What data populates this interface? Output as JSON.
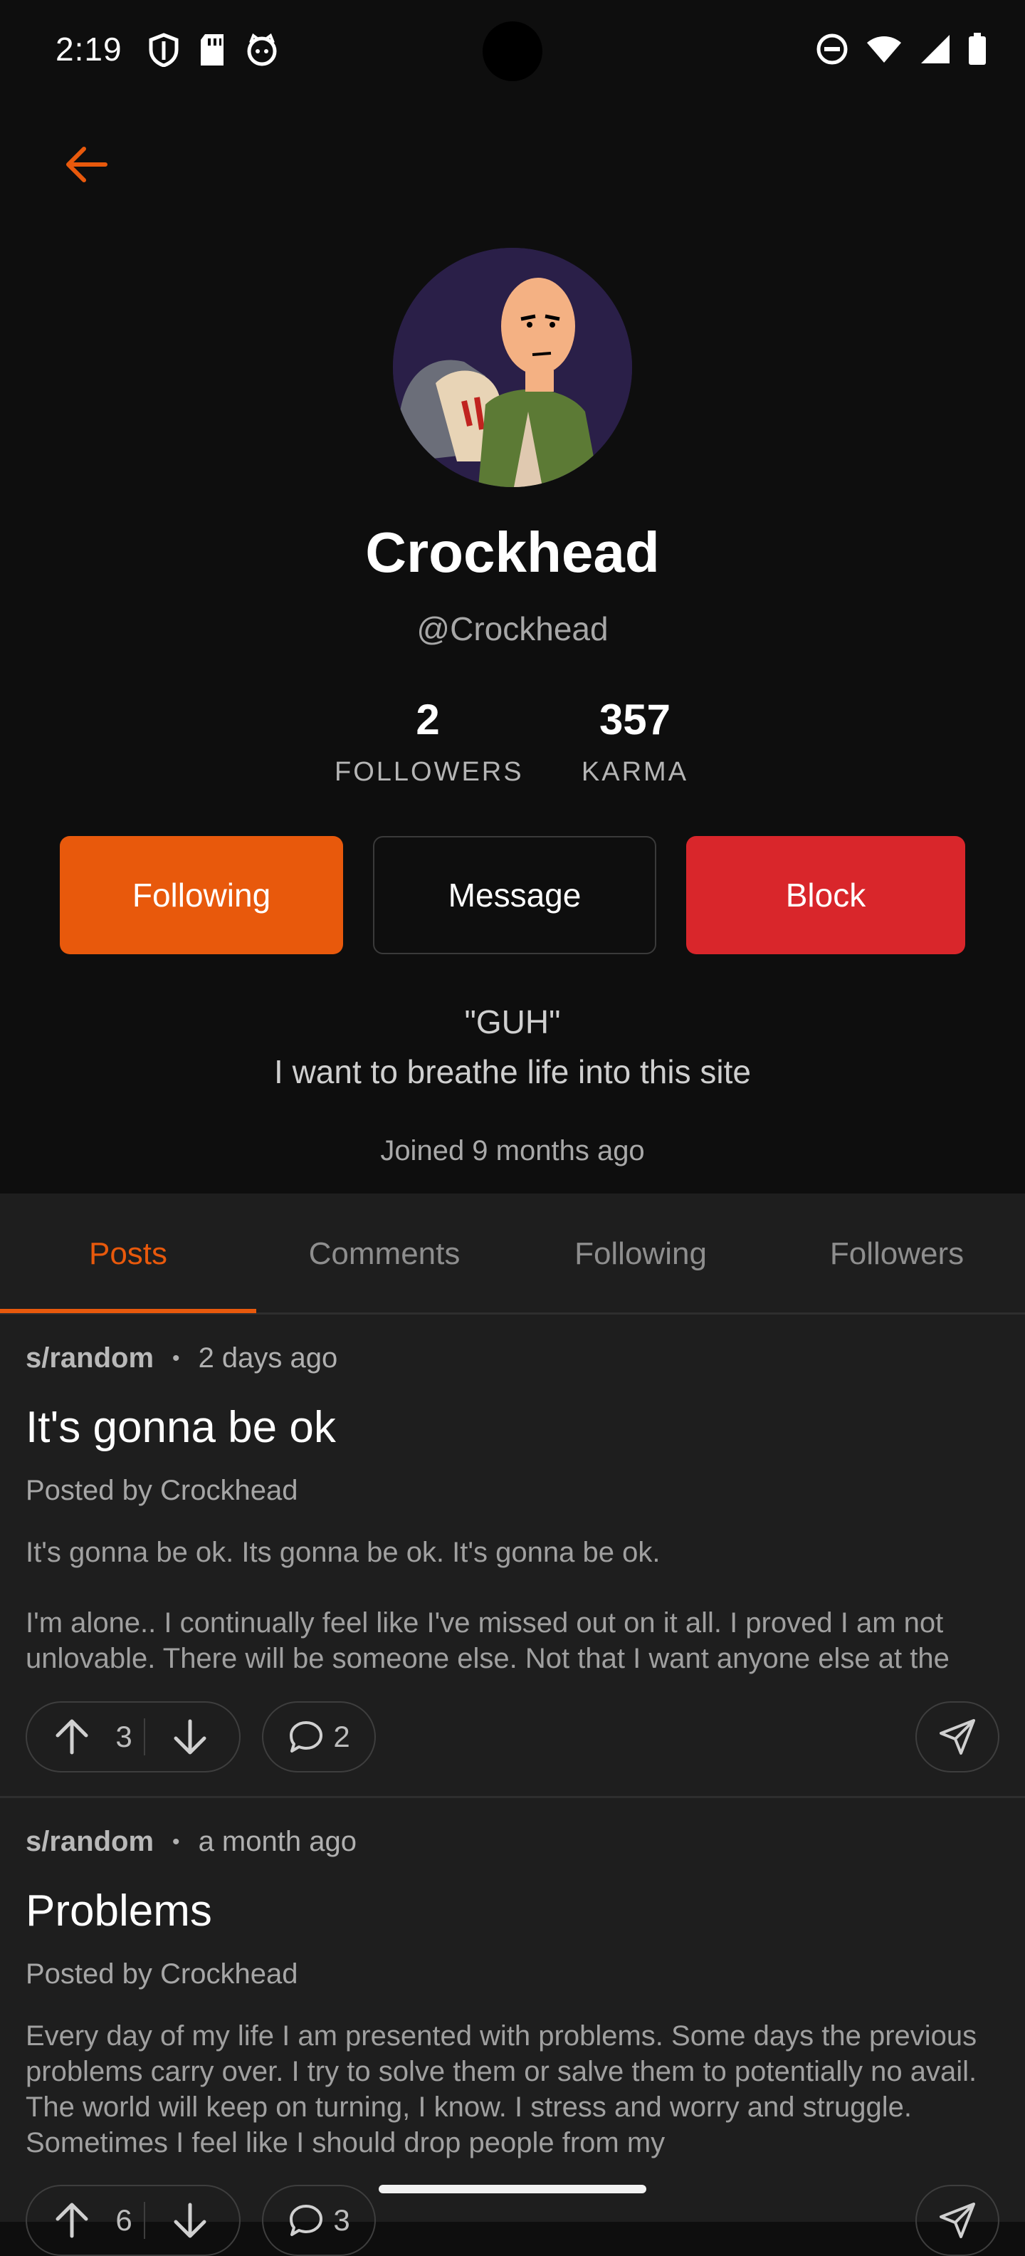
{
  "status_bar": {
    "time": "2:19"
  },
  "profile": {
    "name": "Crockhead",
    "handle": "@Crockhead",
    "followers_count": "2",
    "followers_label": "FOLLOWERS",
    "karma_count": "357",
    "karma_label": "KARMA",
    "bio_line1": "\"GUH\"",
    "bio_line2": "I want to breathe life into this site",
    "joined": "Joined 9 months ago"
  },
  "actions": {
    "following": "Following",
    "message": "Message",
    "block": "Block"
  },
  "tabs": [
    {
      "label": "Posts"
    },
    {
      "label": "Comments"
    },
    {
      "label": "Following"
    },
    {
      "label": "Followers"
    }
  ],
  "posts": [
    {
      "community": "s/random",
      "time": "2 days ago",
      "title": "It's gonna be ok",
      "author": "Posted by Crockhead",
      "body_p1": "It's gonna be ok. Its gonna be ok. It's gonna be ok.",
      "body_p2": "I'm alone.. I continually feel like I've missed out on it all. I proved I am not unlovable. There will be someone else. Not that I want anyone else at the",
      "votes": "3",
      "comments": "2"
    },
    {
      "community": "s/random",
      "time": "a month ago",
      "title": "Problems",
      "author": "Posted by Crockhead",
      "body_p1": "Every day of my life I am presented with problems. Some days the previous problems carry over. I try to solve them or salve them to potentially no avail. The world will keep on turning, I know. I stress and worry and struggle. Sometimes I feel like I should drop people from my",
      "votes": "6",
      "comments": "3"
    }
  ],
  "colors": {
    "accent": "#e8590c",
    "block": "#d9262b",
    "background": "#0e0e0e",
    "card": "#1e1e1e"
  }
}
